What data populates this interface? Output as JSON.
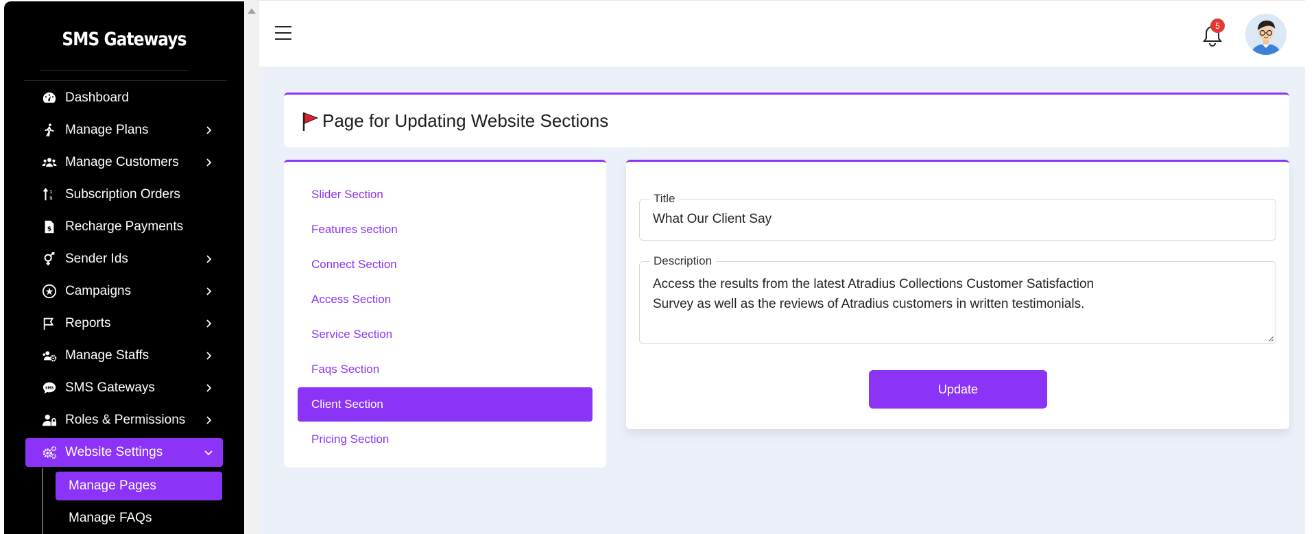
{
  "sidebar": {
    "brand": "SMS Gateways",
    "items": [
      {
        "label": "Dashboard",
        "icon": "dashboard-gauge-icon",
        "chevron": false
      },
      {
        "label": "Manage Plans",
        "icon": "walking-person-icon",
        "chevron": true
      },
      {
        "label": "Manage Customers",
        "icon": "users-group-icon",
        "chevron": true
      },
      {
        "label": "Subscription Orders",
        "icon": "sort-arrows-icon",
        "chevron": false
      },
      {
        "label": "Recharge Payments",
        "icon": "invoice-dollar-icon",
        "chevron": false
      },
      {
        "label": "Sender Ids",
        "icon": "gender-symbol-icon",
        "chevron": true
      },
      {
        "label": "Campaigns",
        "icon": "campaign-circle-icon",
        "chevron": true
      },
      {
        "label": "Reports",
        "icon": "flag-outline-icon",
        "chevron": true
      },
      {
        "label": "Manage Staffs",
        "icon": "staff-gear-icon",
        "chevron": true
      },
      {
        "label": "SMS Gateways",
        "icon": "sms-bubble-icon",
        "chevron": true
      },
      {
        "label": "Roles & Permissions",
        "icon": "user-lock-icon",
        "chevron": true
      },
      {
        "label": "Website Settings",
        "icon": "gears-icon",
        "chevron": true,
        "active": true
      }
    ],
    "subitems": [
      {
        "label": "Manage Pages",
        "active": true
      },
      {
        "label": "Manage FAQs",
        "active": false
      }
    ]
  },
  "header": {
    "notification_count": "5"
  },
  "page": {
    "title": "Page for Updating Website Sections"
  },
  "sections": [
    {
      "label": "Slider Section",
      "active": false
    },
    {
      "label": "Features section",
      "active": false
    },
    {
      "label": "Connect Section",
      "active": false
    },
    {
      "label": "Access Section",
      "active": false
    },
    {
      "label": "Service Section",
      "active": false
    },
    {
      "label": "Faqs Section",
      "active": false
    },
    {
      "label": "Client Section",
      "active": true
    },
    {
      "label": "Pricing Section",
      "active": false
    }
  ],
  "form": {
    "title_label": "Title",
    "title_value": "What Our Client Say",
    "description_label": "Description",
    "description_line1": "Access the results from the latest Atradius Collections Customer Satisfaction",
    "description_line2": "Survey as well as the reviews of Atradius customers in written testimonials.",
    "update_label": "Update"
  },
  "colors": {
    "accent": "#8b33f7",
    "sidebar_bg": "#000000",
    "main_bg": "#ecf0f8",
    "badge": "#e53935"
  }
}
